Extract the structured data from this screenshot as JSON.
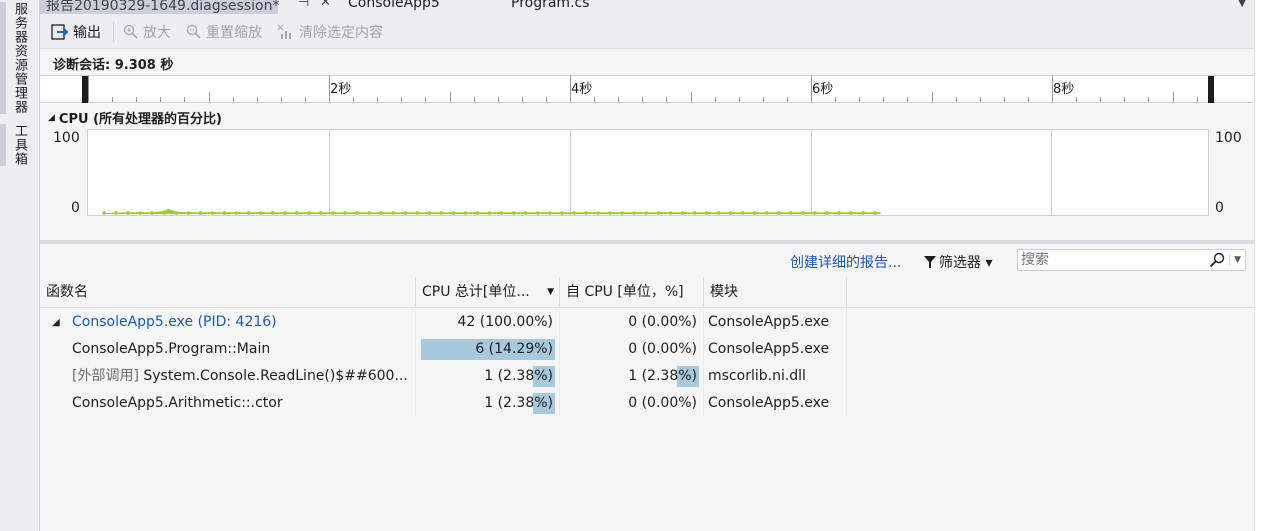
{
  "side_tabs": [
    {
      "label": "服务器资源管理器"
    },
    {
      "label": "工具箱"
    }
  ],
  "doc_tabs": {
    "active": "报告20190329-1649.diagsession*",
    "pin": "⊣",
    "close": "✕",
    "others": [
      "ConsoleApp5",
      "Program.cs"
    ]
  },
  "toolbar": {
    "output_label": "输出",
    "zoom_in_label": "放大",
    "reset_zoom_label": "重置缩放",
    "clear_selection_label": "清除选定内容"
  },
  "session": {
    "label": "诊断会话: 9.308 秒"
  },
  "ruler": {
    "labels": [
      "2秒",
      "4秒",
      "6秒",
      "8秒"
    ]
  },
  "cpu": {
    "title": "CPU (所有处理器的百分比)",
    "y_max": "100",
    "y_min": "0",
    "accent": "#9acd32",
    "chart_data": {
      "type": "area",
      "title": "CPU (所有处理器的百分比)",
      "xlabel": "",
      "ylabel": "",
      "ylim": [
        0,
        100
      ],
      "xlim": [
        0,
        9.308
      ],
      "x": [
        0.0,
        0.2,
        0.4,
        0.5,
        0.56,
        0.62,
        0.7,
        0.9,
        1.2,
        1.6,
        2.0,
        2.5,
        3.0,
        3.5,
        4.0,
        4.5,
        5.0,
        5.5,
        6.0,
        6.5,
        6.73
      ],
      "values": [
        0,
        1,
        1,
        2,
        5,
        2,
        1,
        1,
        1,
        1,
        1,
        1,
        1,
        1,
        1,
        1,
        1,
        1,
        1,
        1,
        1
      ]
    }
  },
  "commands": {
    "create_report": "创建详细的报告...",
    "filter": "筛选器 ▾",
    "search_placeholder": "搜索"
  },
  "table": {
    "columns": [
      "函数名",
      "CPU 总计[单位...",
      "自 CPU [单位，%]",
      "模块"
    ],
    "rows": [
      {
        "name_prefix": "",
        "name": "ConsoleApp5.exe (PID: 4216)",
        "total": "42 (100.00%)",
        "total_pct": 100,
        "self": "0 (0.00%)",
        "self_pct": 0,
        "module": "ConsoleApp5.exe",
        "expanded": true,
        "is_link": true
      },
      {
        "name_prefix": "",
        "name": "ConsoleApp5.Program::Main",
        "total": "6 (14.29%)",
        "total_pct": 14.29,
        "self": "0 (0.00%)",
        "self_pct": 0,
        "module": "ConsoleApp5.exe",
        "expanded": false,
        "is_link": false
      },
      {
        "name_prefix": "[外部调用]",
        "name": " System.Console.ReadLine()$##600...",
        "total": "1 (2.38%)",
        "total_pct": 2.38,
        "self": "1 (2.38%)",
        "self_pct": 2.38,
        "module": "mscorlib.ni.dll",
        "expanded": false,
        "is_link": false
      },
      {
        "name_prefix": "",
        "name": "ConsoleApp5.Arithmetic::.ctor",
        "total": "1 (2.38%)",
        "total_pct": 2.38,
        "self": "0 (0.00%)",
        "self_pct": 0,
        "module": "ConsoleApp5.exe",
        "expanded": false,
        "is_link": false
      }
    ]
  }
}
